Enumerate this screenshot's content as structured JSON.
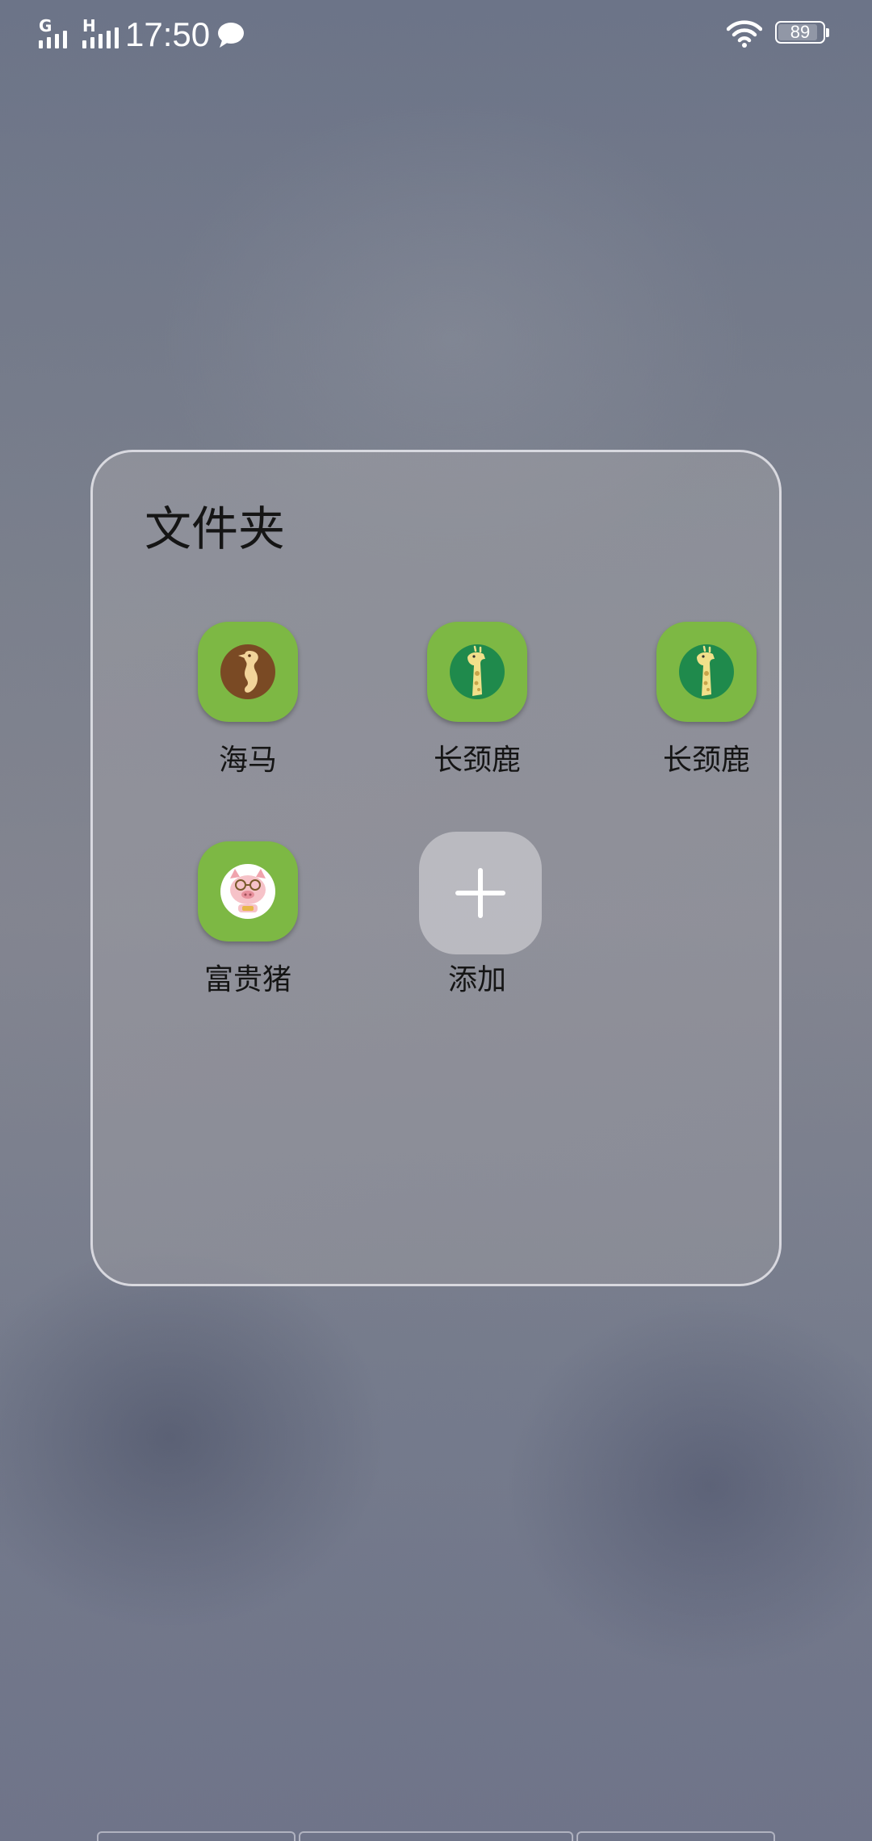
{
  "status_bar": {
    "network_1": "G",
    "network_2": "H",
    "time": "17:50",
    "message_icon": "chat-bubble-icon",
    "wifi_icon": "wifi-icon",
    "battery_level": "89",
    "battery_fraction": 0.89
  },
  "folder": {
    "title": "文件夹",
    "apps": [
      {
        "label": "海马",
        "icon": "seahorse-icon"
      },
      {
        "label": "长颈鹿",
        "icon": "giraffe-icon"
      },
      {
        "label": "长颈鹿",
        "icon": "giraffe-icon"
      },
      {
        "label": "富贵猪",
        "icon": "pig-icon"
      }
    ],
    "add_button": {
      "label": "添加",
      "icon": "plus-icon"
    }
  },
  "colors": {
    "app_icon_green": "#7db844",
    "giraffe_circle": "#1f8a4c",
    "seahorse_circle": "#7a4a24"
  }
}
